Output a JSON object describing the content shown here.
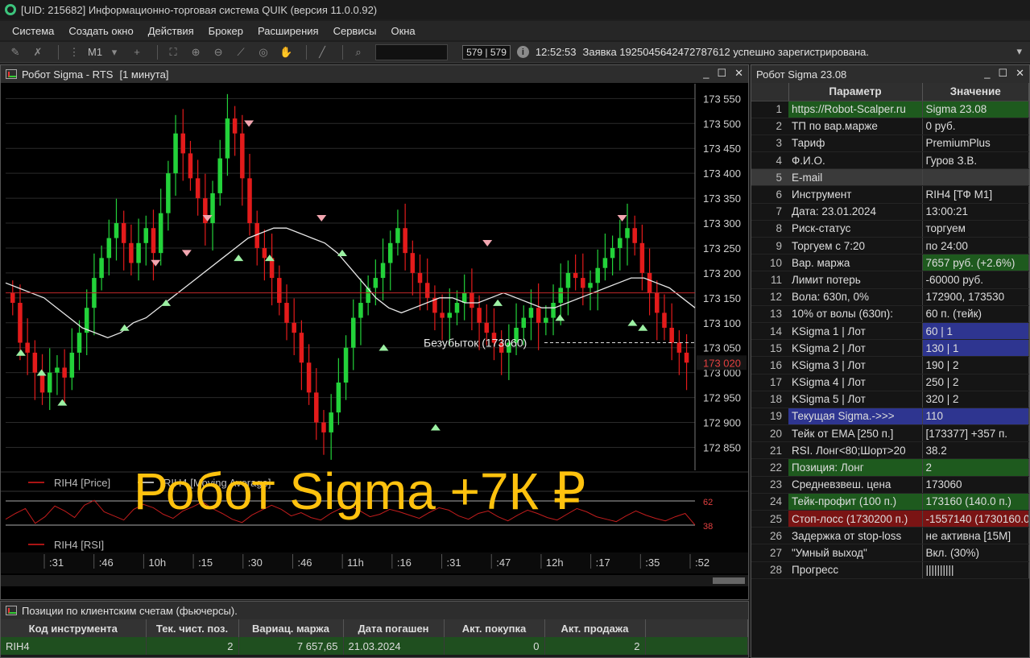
{
  "window": {
    "title": "[UID: 215682] Информационно-торговая система QUIK (версия 11.0.0.92)"
  },
  "menu": [
    "Система",
    "Создать окно",
    "Действия",
    "Брокер",
    "Расширения",
    "Сервисы",
    "Окна"
  ],
  "toolbar": {
    "interval": "M1",
    "tx_counter": "579 | 579",
    "status_time": "12:52:53",
    "status_message": "Заявка 1925045642472787612 успешно зарегистрирована."
  },
  "chart_window": {
    "title": "Робот Sigma - RTS",
    "interval": "[1 минута]",
    "chart_data": {
      "type": "candlestick",
      "instrument": "RIH4",
      "ylim": [
        172820,
        173570
      ],
      "y_ticks": [
        "173 550",
        "173 500",
        "173 450",
        "173 400",
        "173 350",
        "173 300",
        "173 250",
        "173 200",
        "173 150",
        "173 100",
        "173 050",
        "173 000",
        "172 950",
        "172 900",
        "172 850"
      ],
      "last_price_label": "173 020",
      "last_price": 173020,
      "horizontal_level": 173160,
      "breakeven_label": "Безубыток (173060)",
      "breakeven_level": 173060,
      "close_series": [
        173140,
        173060,
        173040,
        173000,
        172960,
        173000,
        173010,
        172990,
        173040,
        173080,
        173130,
        173190,
        173230,
        173270,
        173300,
        173260,
        173220,
        173260,
        173290,
        173240,
        173320,
        173400,
        173480,
        173440,
        173390,
        173350,
        173300,
        173360,
        173430,
        173510,
        173480,
        173390,
        173300,
        173250,
        173230,
        173190,
        173140,
        173100,
        173080,
        173020,
        172960,
        172900,
        172880,
        172920,
        172980,
        173050,
        173110,
        173140,
        173170,
        173190,
        173220,
        173260,
        173290,
        173240,
        173200,
        173180,
        173150,
        173120,
        173110,
        173120,
        173140,
        173160,
        173130,
        173100,
        173080,
        173060,
        173040,
        173060,
        173090,
        173110,
        173130,
        173100,
        173110,
        173140,
        173170,
        173200,
        173190,
        173170,
        173180,
        173210,
        173230,
        173250,
        173270,
        173290,
        173260,
        173200,
        173160,
        173120,
        173090,
        173060,
        173040,
        173020
      ],
      "moving_average": [
        173180,
        173170,
        173160,
        173150,
        173130,
        173110,
        173090,
        173080,
        173070,
        173080,
        173100,
        173110,
        173130,
        173150,
        173170,
        173190,
        173210,
        173230,
        173250,
        173270,
        173280,
        173290,
        173290,
        173280,
        173270,
        173260,
        173240,
        173210,
        173180,
        173150,
        173130,
        173120,
        173130,
        173140,
        173150,
        173150,
        173140,
        173140,
        173150,
        173160,
        173150,
        173140,
        173130,
        173130,
        173140,
        173150,
        173160,
        173170,
        173180,
        173190,
        173190,
        173180,
        173170,
        173150,
        173130
      ],
      "sell_signals": [
        [
          14,
          173210
        ],
        [
          17,
          173230
        ],
        [
          19,
          173300
        ],
        [
          23,
          173490
        ],
        [
          30,
          173300
        ],
        [
          46,
          173250
        ],
        [
          59,
          173300
        ]
      ],
      "buy_signals": [
        [
          1,
          173050
        ],
        [
          3,
          173010
        ],
        [
          5,
          172950
        ],
        [
          11,
          173100
        ],
        [
          15,
          173150
        ],
        [
          22,
          173240
        ],
        [
          25,
          173240
        ],
        [
          32,
          173250
        ],
        [
          36,
          173060
        ],
        [
          41,
          172900
        ],
        [
          47,
          173150
        ],
        [
          53,
          173120
        ],
        [
          60,
          173110
        ],
        [
          61,
          173100
        ]
      ],
      "legend_price": "RIH4 [Price]",
      "legend_ma": "RIH4 [Moving Average]",
      "rsi_legend": "RIH4 [RSI]",
      "rsi_values": [
        45,
        52,
        58,
        40,
        48,
        61,
        55,
        47,
        62,
        68,
        54,
        49,
        44,
        57,
        63,
        59,
        51,
        46,
        55,
        60,
        66,
        58,
        52,
        45,
        41,
        50,
        56,
        62,
        57,
        49,
        53,
        47,
        44,
        52,
        58,
        61,
        55,
        48,
        51,
        57,
        54,
        50,
        46,
        53,
        59,
        56,
        49,
        45,
        52,
        55,
        48,
        43,
        50,
        56,
        52,
        47,
        44,
        51,
        58,
        54,
        48,
        45,
        42,
        49,
        55,
        50,
        46,
        43,
        48,
        52,
        38
      ],
      "rsi_label_top": "62",
      "rsi_label_bottom": "38",
      "time_ticks": [
        ":31",
        ":46",
        "10h",
        ":15",
        ":30",
        ":46",
        "11h",
        ":16",
        ":31",
        ":47",
        "12h",
        ":17",
        ":35",
        ":52"
      ]
    }
  },
  "overlay_text": "Робот Sigma +7К ₽",
  "positions": {
    "title": "Позиции по клиентским счетам (фьючерсы).",
    "columns": [
      "Код инструмента",
      "Тек. чист. поз.",
      "Вариац. маржа",
      "Дата погашен",
      "Акт. покупка",
      "Акт. продажа"
    ],
    "rows": [
      [
        "RIH4",
        "2",
        "7 657,65",
        "21.03.2024",
        "0",
        "2"
      ]
    ]
  },
  "robot": {
    "title": "Робот Sigma 23.08",
    "col_param": "Параметр",
    "col_value": "Значение",
    "colors": {
      "green": "#1e5a1e",
      "gray": "#3a3a3a",
      "blue": "#2e3590",
      "red": "#7a1414"
    },
    "rows": [
      {
        "n": "1",
        "param": "https://Robot-Scalper.ru",
        "value": "Sigma 23.08",
        "hl": "green"
      },
      {
        "n": "2",
        "param": "ТП по вар.марже",
        "value": "0 руб.",
        "hl": ""
      },
      {
        "n": "3",
        "param": "Тариф",
        "value": "PremiumPlus",
        "hl": ""
      },
      {
        "n": "4",
        "param": "Ф.И.О.",
        "value": "Гуров З.В.",
        "hl": ""
      },
      {
        "n": "5",
        "param": "E-mail",
        "value": "",
        "hl": "gray"
      },
      {
        "n": "6",
        "param": "Инструмент",
        "value": "RIH4 [ТФ M1]",
        "hl": ""
      },
      {
        "n": "7",
        "param": "Дата: 23.01.2024",
        "value": "13:00:21",
        "hl": ""
      },
      {
        "n": "8",
        "param": "Риск-статус",
        "value": "торгуем",
        "hl": ""
      },
      {
        "n": "9",
        "param": "Торгуем с 7:20",
        "value": "по 24:00",
        "hl": ""
      },
      {
        "n": "10",
        "param": "Вар. маржа",
        "value": "7657 руб. (+2.6%)",
        "hl": "value-green"
      },
      {
        "n": "11",
        "param": "Лимит потерь",
        "value": "-60000 руб.",
        "hl": ""
      },
      {
        "n": "12",
        "param": "Вола: 630п, 0%",
        "value": "172900, 173530",
        "hl": ""
      },
      {
        "n": "13",
        "param": "10% от волы (630п):",
        "value": "60 п. (тейк)",
        "hl": ""
      },
      {
        "n": "14",
        "param": "KSigma 1 | Лот",
        "value": "60 | 1",
        "hl": "value-blue"
      },
      {
        "n": "15",
        "param": "KSigma 2 | Лот",
        "value": "130 | 1",
        "hl": "value-blue"
      },
      {
        "n": "16",
        "param": "KSigma 3 | Лот",
        "value": "190 | 2",
        "hl": ""
      },
      {
        "n": "17",
        "param": "KSigma 4 | Лот",
        "value": "250 | 2",
        "hl": ""
      },
      {
        "n": "18",
        "param": "KSigma 5 | Лот",
        "value": "320 | 2",
        "hl": ""
      },
      {
        "n": "19",
        "param": "Текущая Sigma.->>>",
        "value": "110",
        "hl": "blue"
      },
      {
        "n": "20",
        "param": "Тейк от EMA [250 п.]",
        "value": "[173377] +357 п.",
        "hl": ""
      },
      {
        "n": "21",
        "param": "RSI. Лонг<80;Шорт>20",
        "value": "38.2",
        "hl": ""
      },
      {
        "n": "22",
        "param": "Позиция: Лонг",
        "value": "2",
        "hl": "green"
      },
      {
        "n": "23",
        "param": "Средневзвеш. цена",
        "value": "173060",
        "hl": ""
      },
      {
        "n": "24",
        "param": "Тейк-профит (100 п.)",
        "value": "173160 (140.0 п.)",
        "hl": "green"
      },
      {
        "n": "25",
        "param": "Стоп-лосс (1730200 п.)",
        "value": "-1557140 (1730160.0",
        "hl": "red"
      },
      {
        "n": "26",
        "param": "Задержка от stop-loss",
        "value": "не активна [15M]",
        "hl": ""
      },
      {
        "n": "27",
        "param": "\"Умный выход\"",
        "value": "Вкл. (30%)",
        "hl": ""
      },
      {
        "n": "28",
        "param": "Прогресс",
        "value": "||||||||||",
        "hl": ""
      }
    ]
  }
}
